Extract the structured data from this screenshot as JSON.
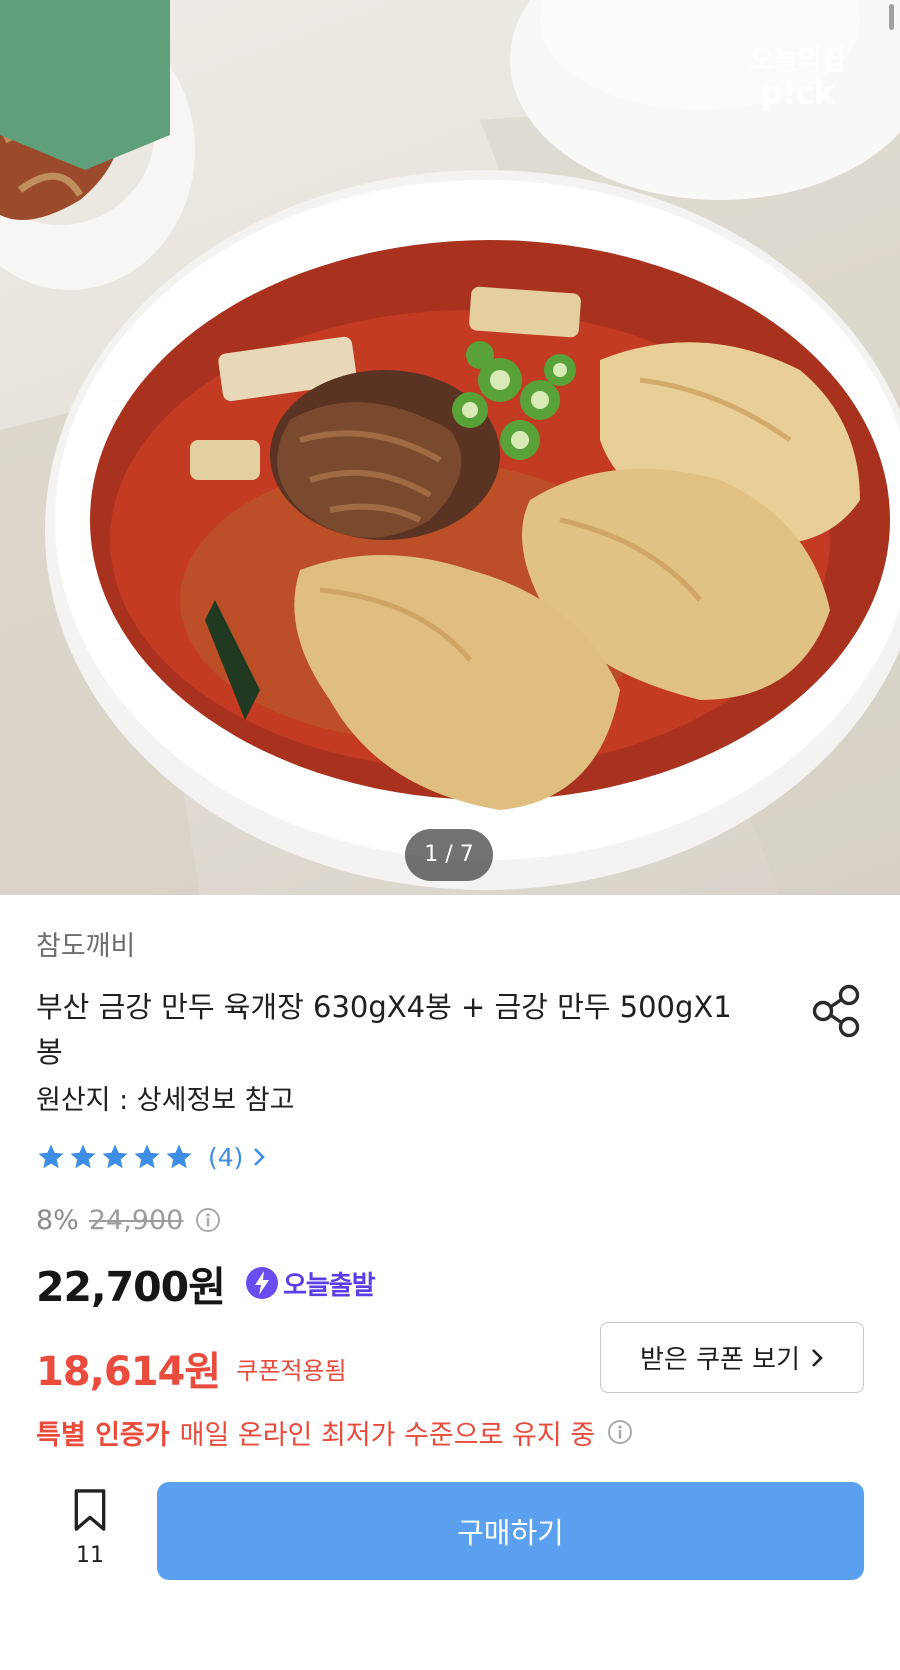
{
  "hero": {
    "badge_line1": "오늘의집",
    "badge_line2": "p!ck",
    "badge_color": "#5fa07a",
    "image_counter": "1 / 7"
  },
  "product": {
    "seller": "참도깨비",
    "title": "부산 금강 만두 육개장 630gX4봉 + 금강 만두 500gX1봉",
    "origin": "원산지 : 상세정보 참고",
    "rating_stars": 5,
    "review_count": "(4)",
    "discount_rate": "8%",
    "original_price": "24,900",
    "sale_price": "22,700원",
    "shipping_label": "오늘출발",
    "coupon_price": "18,614원",
    "coupon_applied_label": "쿠폰적용됨",
    "coupon_button_label": "받은 쿠폰 보기",
    "special_badge": "특별 인증가",
    "special_text": "매일 온라인 최저가 수준으로 유지 중"
  },
  "bottom_bar": {
    "bookmark_count": "11",
    "buy_label": "구매하기"
  },
  "colors": {
    "accent_blue": "#5aa0ee",
    "star_blue": "#3f8de6",
    "red": "#e94b3c",
    "ship_purple": "#5b3ee6"
  },
  "icons": [
    "share-icon",
    "star-icon",
    "chevron-right-icon",
    "info-icon",
    "lightning-icon",
    "bookmark-icon"
  ]
}
